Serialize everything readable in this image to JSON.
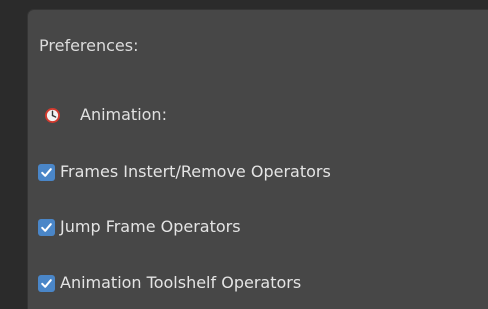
{
  "panel": {
    "title": "Preferences:"
  },
  "section": {
    "icon": "clock-icon",
    "label": "Animation:"
  },
  "options": [
    {
      "label": "Frames Instert/Remove Operators",
      "checked": true
    },
    {
      "label": "Jump Frame Operators",
      "checked": true
    },
    {
      "label": "Animation Toolshelf Operators",
      "checked": true
    }
  ],
  "colors": {
    "checkbox_accent": "#4a86c8",
    "panel_bg": "#474747",
    "clock_red": "#d23a2e"
  }
}
